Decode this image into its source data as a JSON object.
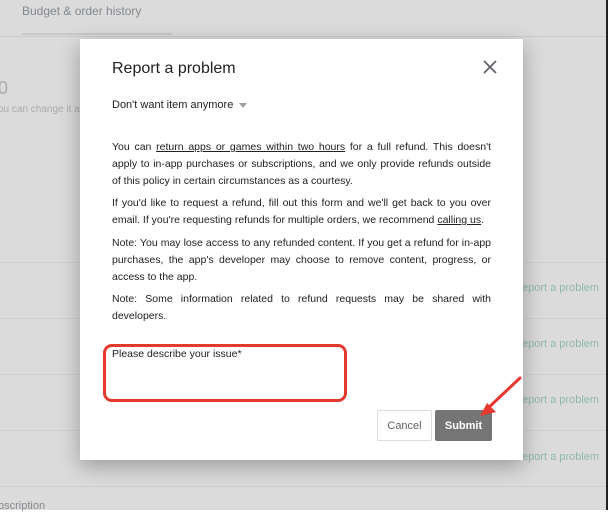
{
  "background": {
    "tab_label": "Budget & order history",
    "balance": "0",
    "change_hint": "ou can change it at",
    "row_links": [
      "eport a problem",
      "eport a problem",
      "eport a problem",
      "eport a problem"
    ],
    "subscription_label": "bscription"
  },
  "dialog": {
    "title": "Report a problem",
    "close_icon": "close-icon",
    "reason_select": "Don't want item anymore",
    "para1": {
      "before": "You can ",
      "link": "return apps or games within two hours",
      "after": " for a full refund. This doesn't apply to in-app purchases or subscriptions, and we only provide refunds outside of this policy in certain circumstances as a courtesy."
    },
    "para2": {
      "before": "If you'd like to request a refund, fill out this form and we'll get back to you over email. If you're requesting refunds for multiple orders, we recommend ",
      "link": "calling us",
      "after": "."
    },
    "para3": "Note: You may lose access to any refunded content. If you get a refund for in-app purchases, the app's developer may choose to remove content, progress, or access to the app.",
    "para4": "Note: Some information related to refund requests may be shared with developers.",
    "issue_label": "Please describe your issue*",
    "issue_value": "",
    "cancel_label": "Cancel",
    "submit_label": "Submit"
  },
  "colors": {
    "annotation": "#e5392f",
    "submit_bg": "#757575",
    "bg_link": "#a8d8c0"
  }
}
